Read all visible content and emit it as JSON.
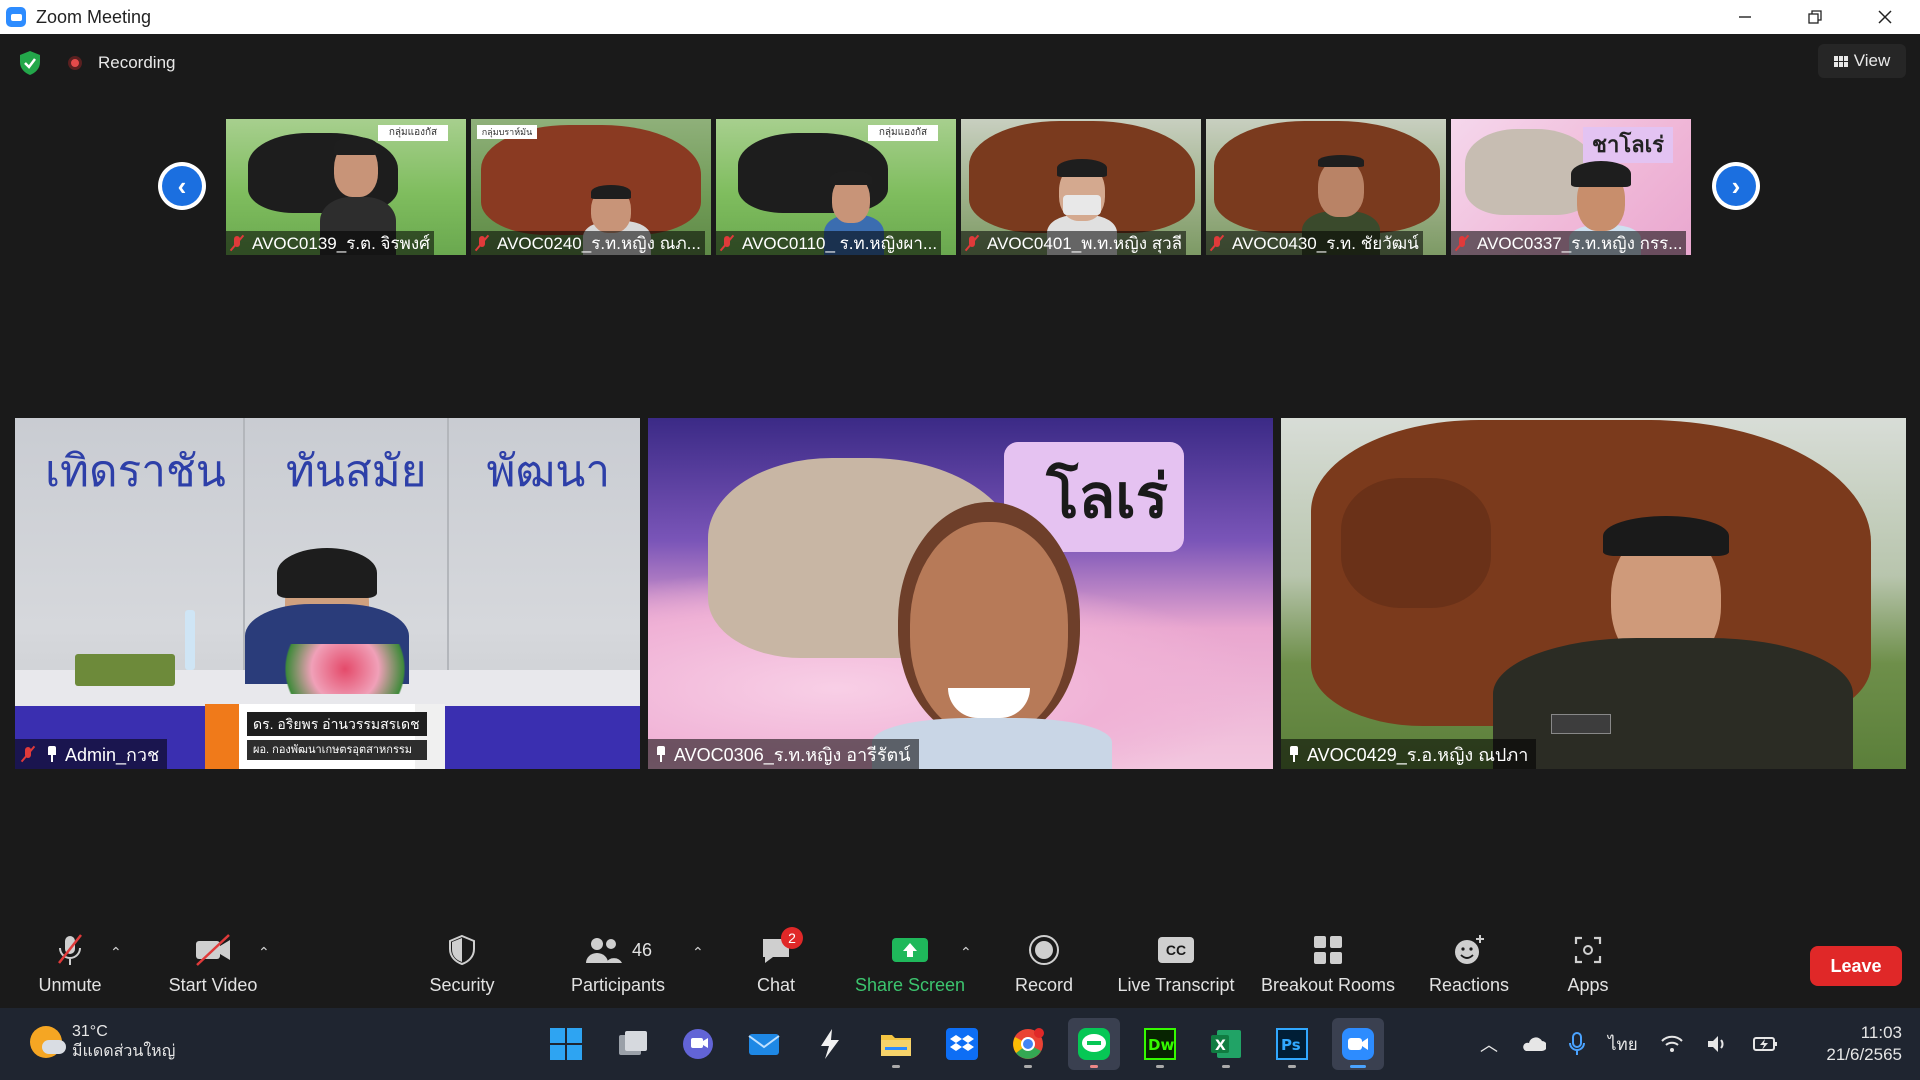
{
  "window": {
    "title": "Zoom Meeting"
  },
  "top": {
    "recording_label": "Recording",
    "view_label": "View"
  },
  "thumbnails": [
    {
      "name": "AVOC0139_ร.ต. จิรพงศ์",
      "sign": "กลุ่มแองกัส"
    },
    {
      "name": "AVOC0240_ร.ท.หญิง ณภ...",
      "sign": "กลุ่มบราห์มัน"
    },
    {
      "name": "AVOC0110_ ร.ท.หญิงผา...",
      "sign": "กลุ่มแองกัส"
    },
    {
      "name": "AVOC0401_พ.ท.หญิง สุวลี",
      "sign": ""
    },
    {
      "name": "AVOC0430_ร.ท. ชัยวัฒน์",
      "sign": ""
    },
    {
      "name": "AVOC0337_ร.ท.หญิง กรร...",
      "sign": "ชาโลเร่"
    }
  ],
  "tiles": [
    {
      "name": "Admin_กวช",
      "banner": [
        "เทิดราชัน",
        "ทันสมัย",
        "พัฒนา"
      ],
      "caption_line1": "ดร. อริยพร  อ่านวรรมสรเดช",
      "caption_line2": "ผอ. กองพัฒนาเกษตรอุตสาหกรรม"
    },
    {
      "name": "AVOC0306_ร.ท.หญิง อารีรัตน์",
      "sign": "โลเร่"
    },
    {
      "name": "AVOC0429_ร.อ.หญิง ณปภา"
    }
  ],
  "toolbar": {
    "unmute": "Unmute",
    "start_video": "Start Video",
    "security": "Security",
    "participants": "Participants",
    "participants_count": "46",
    "chat": "Chat",
    "chat_badge": "2",
    "share_screen": "Share Screen",
    "record": "Record",
    "live_transcript": "Live Transcript",
    "cc": "CC",
    "breakout_rooms": "Breakout Rooms",
    "reactions": "Reactions",
    "apps": "Apps",
    "leave": "Leave"
  },
  "taskbar": {
    "temperature": "31°C",
    "weather": "มีแดดส่วนใหญ่",
    "language": "ไทย",
    "time": "11:03",
    "date": "21/6/2565",
    "apps": [
      "windows-start",
      "task-view",
      "teams-chat",
      "mail",
      "bolt-app",
      "file-explorer",
      "dropbox",
      "chrome",
      "line",
      "dreamweaver",
      "excel",
      "photoshop",
      "zoom"
    ]
  },
  "colors": {
    "accent_blue": "#2d8cff",
    "leave_red": "#e02828",
    "share_green": "#1fb85b",
    "muted_red": "#e03a3a"
  }
}
